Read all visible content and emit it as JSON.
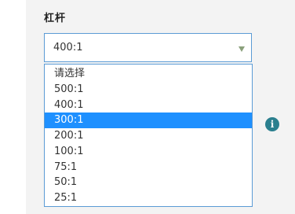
{
  "field": {
    "label": "杠杆",
    "selected_value": "400:1"
  },
  "dropdown": {
    "options": [
      {
        "label": "请选择",
        "selected": false
      },
      {
        "label": "500:1",
        "selected": false
      },
      {
        "label": "400:1",
        "selected": false
      },
      {
        "label": "300:1",
        "selected": true
      },
      {
        "label": "200:1",
        "selected": false
      },
      {
        "label": "100:1",
        "selected": false
      },
      {
        "label": "75:1",
        "selected": false
      },
      {
        "label": "50:1",
        "selected": false
      },
      {
        "label": "25:1",
        "selected": false
      }
    ]
  },
  "info": {
    "icon": "info-icon",
    "glyph": "i"
  },
  "colors": {
    "highlight": "#1e90ff",
    "border": "#5b9bd5",
    "info_icon": "#2a7f8e",
    "arrow": "#8aa07b"
  }
}
